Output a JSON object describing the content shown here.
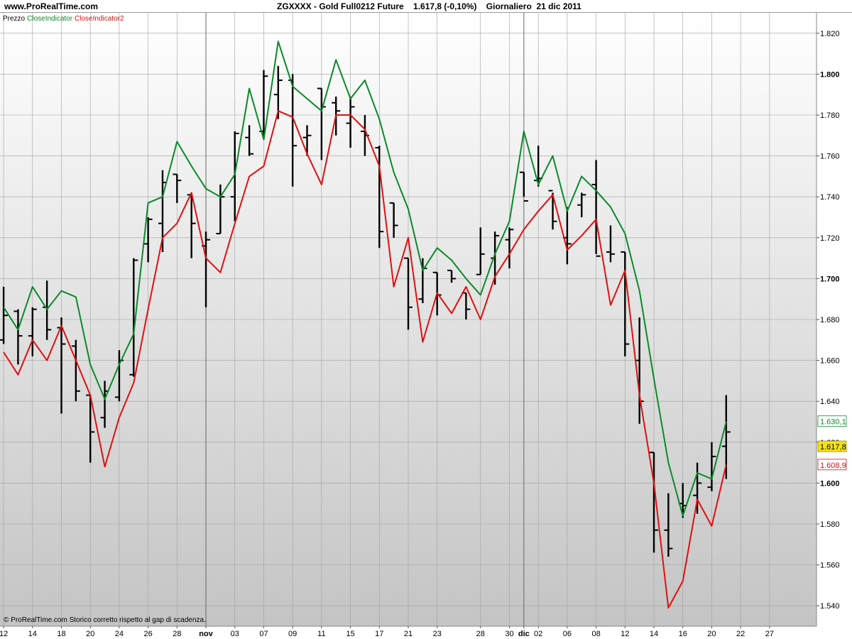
{
  "site": "www.ProRealTime.com",
  "header": {
    "symbol": "ZGXXXX - Gold Full0212 Future",
    "quote": "1.617,8 (-0,10%)",
    "period": "Giornaliero",
    "date": "21 dic 2011"
  },
  "legend": {
    "price": "Prezzo",
    "ind1": "CloseIndicator",
    "ind2": "CloseIndicator2"
  },
  "footnote": "© ProRealTime.com  Storico corretto rispetto al gap di scadenza.",
  "colors": {
    "green": "#0a8a2a",
    "red": "#e01010",
    "bars": "#000000",
    "last_price_bg": "#f7e315",
    "grid": "#a0a0a0"
  },
  "chart_data": {
    "type": "line",
    "title": "ZGXXXX - Gold Full0212 Future",
    "ylim": [
      1530,
      1830
    ],
    "yticks": [
      1540,
      1560,
      1580,
      1600,
      1620,
      1640,
      1660,
      1680,
      1700,
      1720,
      1740,
      1760,
      1780,
      1800,
      1820
    ],
    "ytick_labels": [
      "1.540",
      "1.560",
      "1.580",
      "1.600",
      "1.620",
      "1.640",
      "1.660",
      "1.680",
      "1.700",
      "1.720",
      "1.740",
      "1.760",
      "1.780",
      "1.800",
      "1.820"
    ],
    "xlim": [
      -0.25,
      56.25
    ],
    "xticks": [
      {
        "i": 0,
        "label": "12"
      },
      {
        "i": 2,
        "label": "14"
      },
      {
        "i": 4,
        "label": "18"
      },
      {
        "i": 6,
        "label": "20"
      },
      {
        "i": 8,
        "label": "24"
      },
      {
        "i": 10,
        "label": "26"
      },
      {
        "i": 12,
        "label": "28"
      },
      {
        "i": 14,
        "label": "nov",
        "major": true
      },
      {
        "i": 16,
        "label": "03"
      },
      {
        "i": 18,
        "label": "07"
      },
      {
        "i": 20,
        "label": "09"
      },
      {
        "i": 22,
        "label": "11"
      },
      {
        "i": 24,
        "label": "15"
      },
      {
        "i": 26,
        "label": "17"
      },
      {
        "i": 28,
        "label": "21"
      },
      {
        "i": 30,
        "label": "23"
      },
      {
        "i": 33,
        "label": "28"
      },
      {
        "i": 35,
        "label": "30"
      },
      {
        "i": 36,
        "label": "dic",
        "major": true
      },
      {
        "i": 37,
        "label": "02"
      },
      {
        "i": 39,
        "label": "06"
      },
      {
        "i": 41,
        "label": "08"
      },
      {
        "i": 43,
        "label": "12"
      },
      {
        "i": 45,
        "label": "14"
      },
      {
        "i": 47,
        "label": "16"
      },
      {
        "i": 49,
        "label": "20"
      },
      {
        "i": 51,
        "label": "22"
      },
      {
        "i": 53,
        "label": "27"
      }
    ],
    "bars": [
      {
        "o": 1670,
        "h": 1696,
        "l": 1668,
        "c": 1682
      },
      {
        "o": 1684,
        "h": 1685,
        "l": 1658,
        "c": 1672
      },
      {
        "o": 1672,
        "h": 1686,
        "l": 1662,
        "c": 1685
      },
      {
        "o": 1686,
        "h": 1699,
        "l": 1670,
        "c": 1675
      },
      {
        "o": 1676,
        "h": 1681,
        "l": 1634,
        "c": 1668
      },
      {
        "o": 1667,
        "h": 1670,
        "l": 1640,
        "c": 1645
      },
      {
        "o": 1643,
        "h": 1643,
        "l": 1610,
        "c": 1625
      },
      {
        "o": 1632,
        "h": 1650,
        "l": 1627,
        "c": 1645
      },
      {
        "o": 1642,
        "h": 1665,
        "l": 1640,
        "c": 1660
      },
      {
        "o": 1653,
        "h": 1710,
        "l": 1652,
        "c": 1709
      },
      {
        "o": 1717,
        "h": 1730,
        "l": 1708,
        "c": 1729
      },
      {
        "o": 1727,
        "h": 1753,
        "l": 1713,
        "c": 1747
      },
      {
        "o": 1751,
        "h": 1751,
        "l": 1737,
        "c": 1748
      },
      {
        "o": 1741,
        "h": 1742,
        "l": 1710,
        "c": 1727
      },
      {
        "o": 1716,
        "h": 1723,
        "l": 1686,
        "c": 1719
      },
      {
        "o": 1722,
        "h": 1746,
        "l": 1722,
        "c": 1740
      },
      {
        "o": 1740,
        "h": 1772,
        "l": 1728,
        "c": 1771
      },
      {
        "o": 1769,
        "h": 1775,
        "l": 1760,
        "c": 1761
      },
      {
        "o": 1772,
        "h": 1802,
        "l": 1769,
        "c": 1799
      },
      {
        "o": 1790,
        "h": 1804,
        "l": 1778,
        "c": 1797
      },
      {
        "o": 1797,
        "h": 1800,
        "l": 1745,
        "c": 1765
      },
      {
        "o": 1769,
        "h": 1775,
        "l": 1760,
        "c": 1770
      },
      {
        "o": 1793,
        "h": 1793,
        "l": 1758,
        "c": 1784
      },
      {
        "o": 1786,
        "h": 1789,
        "l": 1770,
        "c": 1782
      },
      {
        "o": 1776,
        "h": 1789,
        "l": 1764,
        "c": 1784
      },
      {
        "o": 1772,
        "h": 1780,
        "l": 1760,
        "c": 1770
      },
      {
        "o": 1764,
        "h": 1765,
        "l": 1715,
        "c": 1723
      },
      {
        "o": 1737,
        "h": 1737,
        "l": 1720,
        "c": 1726
      },
      {
        "o": 1710,
        "h": 1710,
        "l": 1675,
        "c": 1686
      },
      {
        "o": 1690,
        "h": 1710,
        "l": 1688,
        "c": 1705
      },
      {
        "o": 1703,
        "h": 1703,
        "l": 1682,
        "c": 1692
      },
      {
        "o": 1704,
        "h": 1704,
        "l": 1698,
        "c": 1700
      },
      {
        "o": 1693,
        "h": 1693,
        "l": 1680,
        "c": 1685
      },
      {
        "o": 1702,
        "h": 1725,
        "l": 1702,
        "c": 1712
      },
      {
        "o": 1710,
        "h": 1723,
        "l": 1697,
        "c": 1721
      },
      {
        "o": 1719,
        "h": 1725,
        "l": 1705,
        "c": 1724
      },
      {
        "o": 1752,
        "h": 1752,
        "l": 1740,
        "c": 1738
      },
      {
        "o": 1748,
        "h": 1765,
        "l": 1745,
        "c": 1749
      },
      {
        "o": 1743,
        "h": 1742,
        "l": 1724,
        "c": 1728
      },
      {
        "o": 1720,
        "h": 1735,
        "l": 1707,
        "c": 1717
      },
      {
        "o": 1736,
        "h": 1742,
        "l": 1730,
        "c": 1741
      },
      {
        "o": 1746,
        "h": 1758,
        "l": 1712,
        "c": 1711
      },
      {
        "o": 1713,
        "h": 1726,
        "l": 1708,
        "c": 1712
      },
      {
        "o": 1713,
        "h": 1713,
        "l": 1662,
        "c": 1668
      },
      {
        "o": 1660,
        "h": 1681,
        "l": 1629,
        "c": 1640
      },
      {
        "o": 1615,
        "h": 1615,
        "l": 1566,
        "c": 1577
      },
      {
        "o": 1577,
        "h": 1595,
        "l": 1564,
        "c": 1568
      },
      {
        "o": 1590,
        "h": 1600,
        "l": 1583,
        "c": 1589
      },
      {
        "o": 1594,
        "h": 1610,
        "l": 1585,
        "c": 1600
      },
      {
        "o": 1598,
        "h": 1620,
        "l": 1596,
        "c": 1613
      },
      {
        "o": 1618,
        "h": 1643,
        "l": 1602,
        "c": 1625
      }
    ],
    "series": [
      {
        "name": "CloseIndicator",
        "color": "#0a8a2a",
        "values": [
          1686,
          1675,
          1696,
          1685,
          1694,
          1691,
          1658,
          1641,
          1658,
          1673,
          1737,
          1740,
          1767,
          1755,
          1744,
          1740,
          1751,
          1793,
          1768,
          1816,
          1794,
          1788,
          1782,
          1807,
          1788,
          1797,
          1778,
          1752,
          1734,
          1704,
          1715,
          1709,
          1700,
          1692,
          1712,
          1728,
          1772,
          1746,
          1760,
          1733,
          1750,
          1743,
          1735,
          1722,
          1694,
          1651,
          1610,
          1584,
          1605,
          1602,
          1630
        ]
      },
      {
        "name": "CloseIndicator2",
        "color": "#e01010",
        "values": [
          1664,
          1653,
          1670,
          1660,
          1677,
          1660,
          1643,
          1608,
          1632,
          1649,
          1685,
          1720,
          1727,
          1742,
          1710,
          1703,
          1727,
          1750,
          1755,
          1782,
          1779,
          1761,
          1746,
          1780,
          1780,
          1773,
          1755,
          1696,
          1720,
          1669,
          1693,
          1683,
          1696,
          1680,
          1701,
          1712,
          1724,
          1733,
          1741,
          1714,
          1721,
          1729,
          1687,
          1704,
          1643,
          1600,
          1539,
          1552,
          1592,
          1579,
          1609
        ]
      }
    ],
    "price_labels": [
      {
        "value": 1630.1,
        "text": "1.630,1",
        "color": "#0a8a2a",
        "kind": "green"
      },
      {
        "value": 1617.8,
        "text": "1.617,8",
        "color": "#000000",
        "kind": "last"
      },
      {
        "value": 1608.9,
        "text": "1.608,9",
        "color": "#e01010",
        "kind": "red"
      }
    ]
  }
}
